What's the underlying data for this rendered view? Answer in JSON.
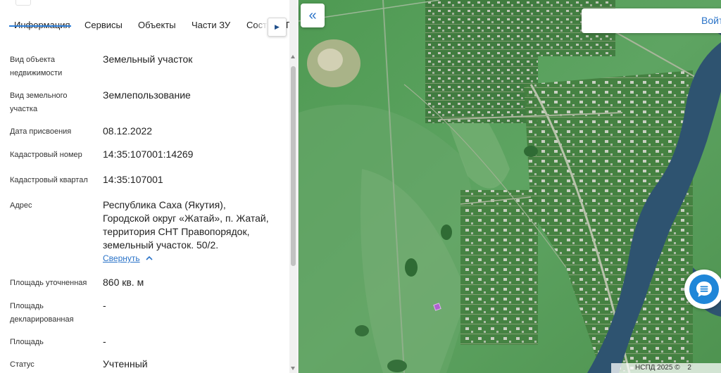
{
  "tabs": {
    "items": [
      "Информация",
      "Сервисы",
      "Объекты",
      "Части ЗУ",
      "Соста"
    ],
    "active_index": 0,
    "tail_fragment": "Г"
  },
  "info": {
    "type_label": "Вид объекта недвижимости",
    "type_value": "Земельный участок",
    "landkind_label": "Вид земельного участка",
    "landkind_value": "Землепользование",
    "date_label": "Дата присвоения",
    "date_value": "08.12.2022",
    "cadnum_label": "Кадастровый номер",
    "cadnum_value": "14:35:107001:14269",
    "quarter_label": "Кадастровый квартал",
    "quarter_value": "14:35:107001",
    "address_label": "Адрес",
    "address_lines": [
      "Республика Саха (Якутия),",
      "Городской округ «Жатай», п. Жатай,",
      "территория СНТ Правопорядок,",
      "земельный участок. 50/2."
    ],
    "collapse_label": "Свернуть",
    "area_precise_label": "Площадь уточненная",
    "area_precise_value": "860 кв. м",
    "area_declared_label": "Площадь декларированная",
    "area_declared_value": "-",
    "area_label": "Площадь",
    "area_value": "-",
    "status_label": "Статус",
    "status_value": "Учтенный"
  },
  "map": {
    "login_label": "Войти",
    "attribution": "НСПД 2025 ©",
    "attribution_tail": "2"
  },
  "colors": {
    "accent": "#2a73c8",
    "tab_underline": "#2d7ed7",
    "chat_button": "#1f86d8",
    "parcel_highlight": "#b060d0"
  },
  "icons": {
    "collapse_panel": "double-chevron-left-icon",
    "tab_next": "triangle-right-icon",
    "collapse_link": "chevron-up-icon",
    "chat": "chat-bubble-icon"
  }
}
